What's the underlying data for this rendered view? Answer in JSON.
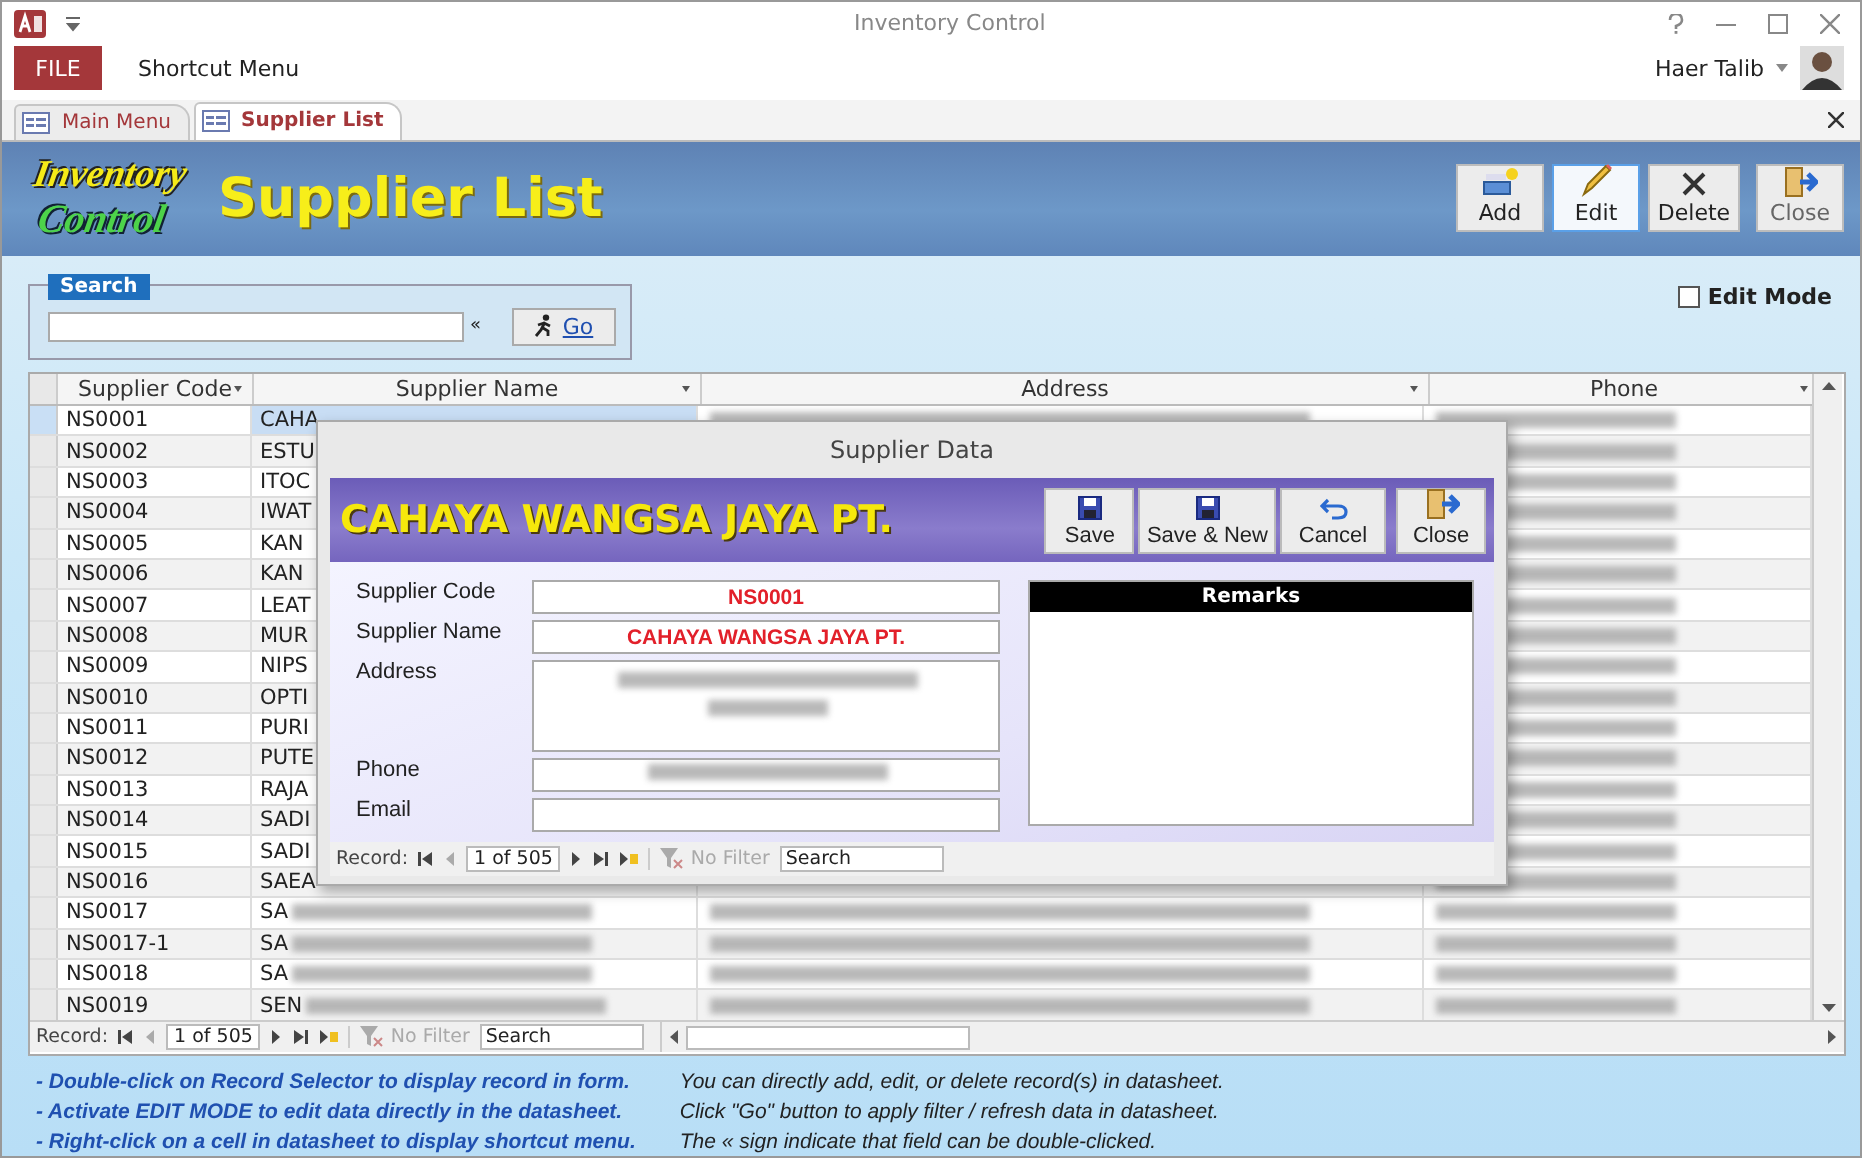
{
  "window": {
    "title": "Inventory Control",
    "user": "Haer Talib"
  },
  "ribbon": {
    "file_tab": "FILE",
    "items": [
      "Shortcut Menu"
    ]
  },
  "doc_tabs": [
    {
      "label": "Main Menu",
      "selected": false
    },
    {
      "label": "Supplier List",
      "selected": true
    }
  ],
  "header": {
    "logo_line1": "Inventory",
    "logo_line2": "Control",
    "title": "Supplier List",
    "buttons": [
      {
        "label": "Add",
        "focused": false
      },
      {
        "label": "Edit",
        "focused": true
      },
      {
        "label": "Delete",
        "focused": false
      },
      {
        "label": "Close",
        "focused": false
      }
    ]
  },
  "search": {
    "legend": "Search",
    "marker": "«",
    "go": "Go"
  },
  "edit_mode": {
    "label": "Edit Mode",
    "checked": false
  },
  "datasheet": {
    "columns": [
      "Supplier Code",
      "Supplier Name",
      "Address",
      "Phone"
    ],
    "rows": [
      {
        "code": "NS0001",
        "name": "CAHA",
        "selected": true,
        "name_blurred": false,
        "address_blurred": true,
        "phone_blurred": true
      },
      {
        "code": "NS0002",
        "name": "ESTU",
        "selected": false,
        "name_blurred": false,
        "address_blurred": false,
        "phone_blurred": true
      },
      {
        "code": "NS0003",
        "name": "ITOC",
        "selected": false,
        "name_blurred": false,
        "address_blurred": false,
        "phone_blurred": true
      },
      {
        "code": "NS0004",
        "name": "IWAT",
        "selected": false,
        "name_blurred": false,
        "address_blurred": false,
        "phone_blurred": true
      },
      {
        "code": "NS0005",
        "name": "KAN",
        "selected": false,
        "name_blurred": false,
        "address_blurred": false,
        "phone_blurred": true
      },
      {
        "code": "NS0006",
        "name": "KAN",
        "selected": false,
        "name_blurred": false,
        "address_blurred": false,
        "phone_blurred": true
      },
      {
        "code": "NS0007",
        "name": "LEAT",
        "selected": false,
        "name_blurred": false,
        "address_blurred": false,
        "phone_blurred": true
      },
      {
        "code": "NS0008",
        "name": "MUR",
        "selected": false,
        "name_blurred": false,
        "address_blurred": false,
        "phone_blurred": true
      },
      {
        "code": "NS0009",
        "name": "NIPS",
        "selected": false,
        "name_blurred": false,
        "address_blurred": false,
        "phone_blurred": true
      },
      {
        "code": "NS0010",
        "name": "OPTI",
        "selected": false,
        "name_blurred": false,
        "address_blurred": false,
        "phone_blurred": true
      },
      {
        "code": "NS0011",
        "name": "PURI",
        "selected": false,
        "name_blurred": false,
        "address_blurred": false,
        "phone_blurred": true
      },
      {
        "code": "NS0012",
        "name": "PUTE",
        "selected": false,
        "name_blurred": false,
        "address_blurred": false,
        "phone_blurred": true
      },
      {
        "code": "NS0013",
        "name": "RAJA",
        "selected": false,
        "name_blurred": false,
        "address_blurred": false,
        "phone_blurred": true
      },
      {
        "code": "NS0014",
        "name": "SADI",
        "selected": false,
        "name_blurred": false,
        "address_blurred": false,
        "phone_blurred": true
      },
      {
        "code": "NS0015",
        "name": "SADI",
        "selected": false,
        "name_blurred": false,
        "address_blurred": false,
        "phone_blurred": true
      },
      {
        "code": "NS0016",
        "name": "SAEA",
        "selected": false,
        "name_blurred": false,
        "address_blurred": false,
        "phone_blurred": true
      },
      {
        "code": "NS0017",
        "name": "SA",
        "selected": false,
        "name_blurred": true,
        "address_blurred": true,
        "phone_blurred": true
      },
      {
        "code": "NS0017-1",
        "name": "SA",
        "selected": false,
        "name_blurred": true,
        "address_blurred": true,
        "phone_blurred": true
      },
      {
        "code": "NS0018",
        "name": "SA",
        "selected": false,
        "name_blurred": true,
        "address_blurred": true,
        "phone_blurred": true
      },
      {
        "code": "NS0019",
        "name": "SEN",
        "selected": false,
        "name_blurred": true,
        "address_blurred": true,
        "phone_blurred": true
      }
    ],
    "nav": {
      "label": "Record:",
      "position": "1 of 505",
      "filter": "No Filter",
      "search": "Search"
    }
  },
  "notes_left": [
    "- Double-click on Record Selector to display record in form.",
    "- Activate EDIT MODE to edit data directly in the datasheet.",
    "- Right-click on a cell in datasheet to display shortcut menu."
  ],
  "notes_right": [
    "You can directly add, edit, or delete record(s) in datasheet.",
    "Click \"Go\" button to apply filter / refresh data in datasheet.",
    "The « sign indicate that field can be double-clicked."
  ],
  "dialog": {
    "title": "Supplier Data",
    "heading": "CAHAYA WANGSA JAYA PT.",
    "buttons": [
      "Save",
      "Save & New",
      "Cancel",
      "Close"
    ],
    "fields": [
      {
        "label": "Supplier Code",
        "kind": "text",
        "value": "NS0001",
        "blurred": false
      },
      {
        "label": "Supplier Name",
        "kind": "text",
        "value": "CAHAYA WANGSA JAYA PT.",
        "blurred": false
      },
      {
        "label": "Address",
        "kind": "multiline",
        "blurred": true
      },
      {
        "label": "Phone",
        "kind": "text",
        "blurred": true
      },
      {
        "label": "Email",
        "kind": "text",
        "blurred": false
      }
    ],
    "remarks": "Remarks",
    "nav": {
      "label": "Record:",
      "position": "1 of 505",
      "filter": "No Filter",
      "search": "Search"
    }
  }
}
